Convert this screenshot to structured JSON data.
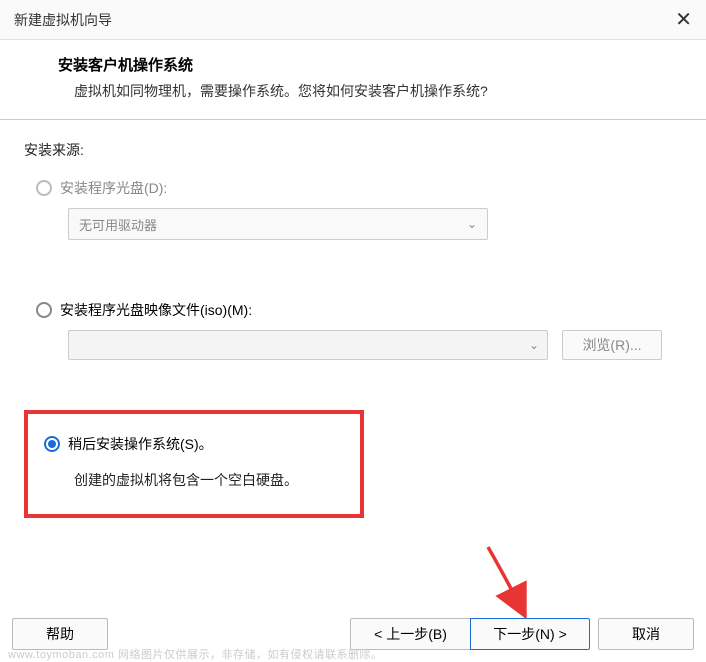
{
  "window": {
    "title": "新建虚拟机向导"
  },
  "header": {
    "heading": "安装客户机操作系统",
    "subheading": "虚拟机如同物理机，需要操作系统。您将如何安装客户机操作系统?"
  },
  "content": {
    "source_label": "安装来源:",
    "option_disc": {
      "label": "安装程序光盘(D):",
      "selected_value": "无可用驱动器"
    },
    "option_iso": {
      "label": "安装程序光盘映像文件(iso)(M):",
      "browse_label": "浏览(R)..."
    },
    "option_later": {
      "label": "稍后安装操作系统(S)。",
      "description": "创建的虚拟机将包含一个空白硬盘。"
    }
  },
  "footer": {
    "help": "帮助",
    "back": "< 上一步(B)",
    "next": "下一步(N) >",
    "cancel": "取消"
  },
  "watermark": "www.toymoban.com  网络图片仅供展示，非存储，如有侵权请联系删除。"
}
